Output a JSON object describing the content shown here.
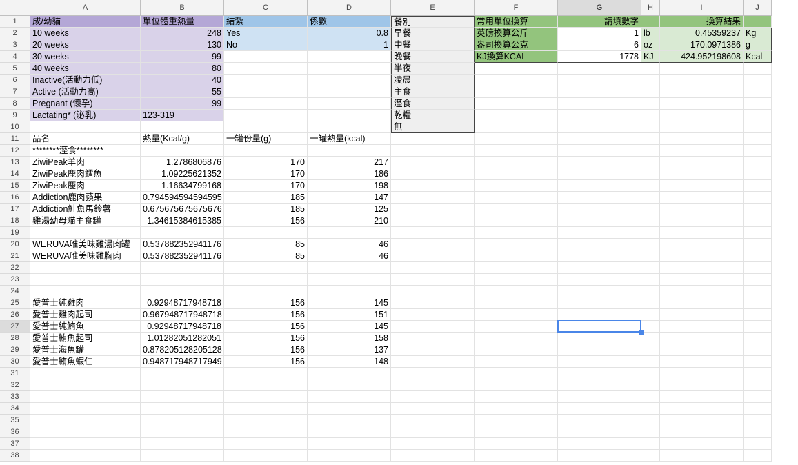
{
  "columns": [
    "A",
    "B",
    "C",
    "D",
    "E",
    "F",
    "G",
    "H",
    "I",
    "J"
  ],
  "rows": [
    "1",
    "2",
    "3",
    "4",
    "5",
    "6",
    "7",
    "8",
    "9",
    "10",
    "11",
    "12",
    "13",
    "14",
    "15",
    "16",
    "17",
    "18",
    "19",
    "20",
    "21",
    "22",
    "23",
    "24",
    "25",
    "26",
    "27",
    "28",
    "29",
    "30",
    "31",
    "32",
    "33",
    "34",
    "35",
    "36",
    "37",
    "38"
  ],
  "selected_cell": "G27",
  "weight_table": {
    "header": {
      "stage": "成/幼貓",
      "kcal": "單位體重熱量"
    },
    "rows": [
      {
        "stage": "10 weeks",
        "kcal": "248"
      },
      {
        "stage": "20 weeks",
        "kcal": "130"
      },
      {
        "stage": "30 weeks",
        "kcal": "99"
      },
      {
        "stage": "40 weeks",
        "kcal": "80"
      },
      {
        "stage": "Inactive(活動力低)",
        "kcal": "40"
      },
      {
        "stage": "Active (活動力高)",
        "kcal": "55"
      },
      {
        "stage": "Pregnant (懷孕)",
        "kcal": "99"
      },
      {
        "stage": "Lactating* (泌乳)",
        "kcal": "123-319"
      }
    ]
  },
  "neuter_table": {
    "header": {
      "label": "結紮",
      "factor": "係數"
    },
    "rows": [
      {
        "label": "Yes",
        "factor": "0.8"
      },
      {
        "label": "No",
        "factor": "1"
      }
    ]
  },
  "meal_table": {
    "header": "餐別",
    "items": [
      "早餐",
      "中餐",
      "晚餐",
      "半夜",
      "凌晨",
      "主食",
      "溼食",
      "乾糧",
      "無"
    ]
  },
  "unit_table": {
    "header": {
      "name": "常用單位換算",
      "input": "請填數字",
      "result": "換算結果"
    },
    "rows": [
      {
        "name": "英磅換算公斤",
        "input": "1",
        "from_unit": "lb",
        "result": "0.45359237",
        "to_unit": "Kg"
      },
      {
        "name": "盎司換算公克",
        "input": "6",
        "from_unit": "oz",
        "result": "170.0971386",
        "to_unit": "g"
      },
      {
        "name": "KJ換算KCAL",
        "input": "1778",
        "from_unit": "KJ",
        "result": "424.952198608",
        "to_unit": "Kcal"
      }
    ]
  },
  "food_table": {
    "header": {
      "name": "品名",
      "kcal_g": "熱量(Kcal/g)",
      "can_g": "一罐份量(g)",
      "can_kcal": "一罐熱量(kcal)"
    },
    "section_label": "********溼食********",
    "rows": [
      {
        "row": 13,
        "name": "ZiwiPeak羊肉",
        "kcal_g": "1.2786806876",
        "can_g": "170",
        "can_kcal": "217"
      },
      {
        "row": 14,
        "name": "ZiwiPeak鹿肉鱈魚",
        "kcal_g": "1.09225621352",
        "can_g": "170",
        "can_kcal": "186"
      },
      {
        "row": 15,
        "name": "ZiwiPeak鹿肉",
        "kcal_g": "1.16634799168",
        "can_g": "170",
        "can_kcal": "198"
      },
      {
        "row": 16,
        "name": "Addiction鹿肉蘋果",
        "kcal_g": "0.794594594594595",
        "can_g": "185",
        "can_kcal": "147"
      },
      {
        "row": 17,
        "name": "Addiction鮭魚馬鈴薯",
        "kcal_g": "0.675675675675676",
        "can_g": "185",
        "can_kcal": "125"
      },
      {
        "row": 18,
        "name": "雞湯幼母貓主食罐",
        "kcal_g": "1.34615384615385",
        "can_g": "156",
        "can_kcal": "210"
      },
      {
        "row": 20,
        "name": "WERUVA唯美味雞湯肉罐",
        "kcal_g": "0.537882352941176",
        "can_g": "85",
        "can_kcal": "46"
      },
      {
        "row": 21,
        "name": "WERUVA唯美味雞胸肉",
        "kcal_g": "0.537882352941176",
        "can_g": "85",
        "can_kcal": "46"
      },
      {
        "row": 25,
        "name": "愛普士純雞肉",
        "kcal_g": "0.92948717948718",
        "can_g": "156",
        "can_kcal": "145"
      },
      {
        "row": 26,
        "name": "愛普士雞肉起司",
        "kcal_g": "0.967948717948718",
        "can_g": "156",
        "can_kcal": "151"
      },
      {
        "row": 27,
        "name": "愛普士純鮪魚",
        "kcal_g": "0.92948717948718",
        "can_g": "156",
        "can_kcal": "145"
      },
      {
        "row": 28,
        "name": "愛普士鮪魚起司",
        "kcal_g": "1.01282051282051",
        "can_g": "156",
        "can_kcal": "158"
      },
      {
        "row": 29,
        "name": "愛普士海魚罐",
        "kcal_g": "0.878205128205128",
        "can_g": "156",
        "can_kcal": "137"
      },
      {
        "row": 30,
        "name": "愛普士鮪魚蝦仁",
        "kcal_g": "0.948717948717949",
        "can_g": "156",
        "can_kcal": "148"
      }
    ]
  }
}
